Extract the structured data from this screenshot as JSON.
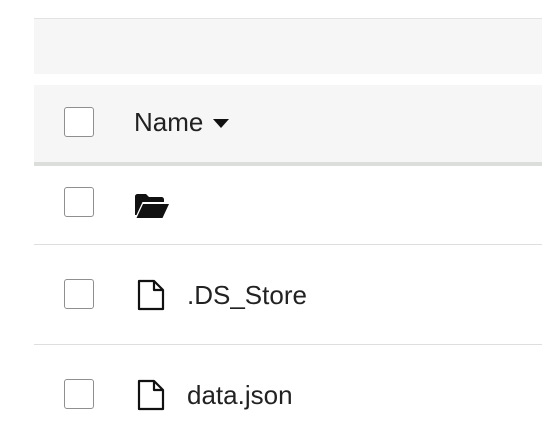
{
  "file_table": {
    "header": {
      "name_label": "Name"
    },
    "rows": [
      {
        "type": "parent-folder",
        "icon": "folder-open-icon",
        "name": ""
      },
      {
        "type": "file",
        "icon": "file-icon",
        "name": ".DS_Store"
      },
      {
        "type": "file",
        "icon": "file-icon",
        "name": "data.json"
      }
    ]
  }
}
